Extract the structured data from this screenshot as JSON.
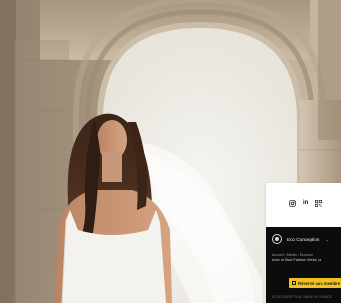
{
  "social": {
    "icons": [
      "instagram-icon",
      "linkedin-icon",
      "qr-code-icon"
    ],
    "linkedin_label": "in"
  },
  "panel": {
    "brand_label": "Eco Conception",
    "chevron": "⌄",
    "breadcrumb": "Accueil › Média › Économ",
    "subtitle": "Avec la Slow Fashion Week, la",
    "reserve_button": "Réservé aux membre",
    "footer_note": "ÉCOCONCEPTION, MADE IN FRANCE"
  },
  "colors": {
    "panel_bg": "#0c0c0c",
    "accent_yellow": "#f2c21b",
    "stone": "#b9a892",
    "sky": "#f1efe9"
  }
}
